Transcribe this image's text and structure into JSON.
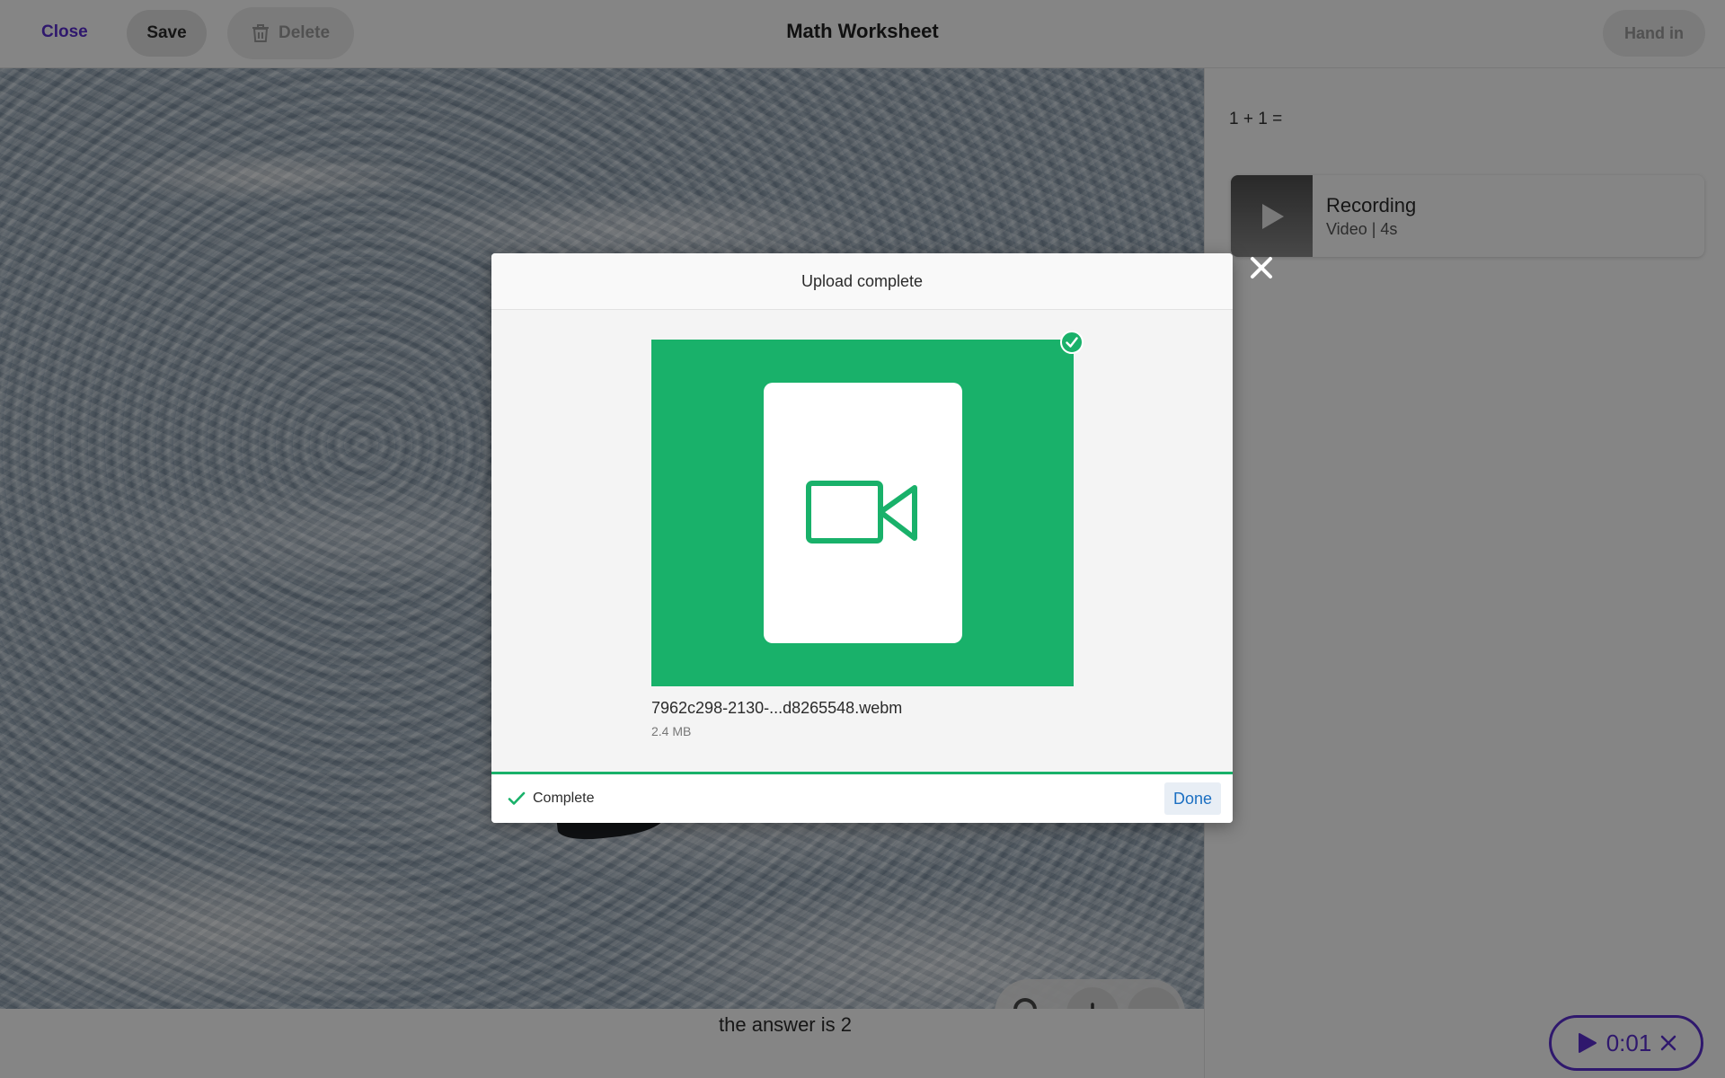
{
  "toolbar": {
    "close_label": "Close",
    "save_label": "Save",
    "delete_label": "Delete",
    "title": "Math Worksheet",
    "handin_label": "Hand in"
  },
  "canvas": {
    "caption": "the answer is 2"
  },
  "panel": {
    "question": "1 + 1 =",
    "recording": {
      "title": "Recording",
      "subtitle": "Video | 4s"
    }
  },
  "recorder": {
    "elapsed": "0:01"
  },
  "modal": {
    "title": "Upload complete",
    "file_name": "7962c298-2130-...d8265548.webm",
    "file_size": "2.4 MB",
    "status": "Complete",
    "done_label": "Done"
  },
  "colors": {
    "accent": "#5b2fd1",
    "success": "#19b16a",
    "link": "#1b6fc2"
  }
}
